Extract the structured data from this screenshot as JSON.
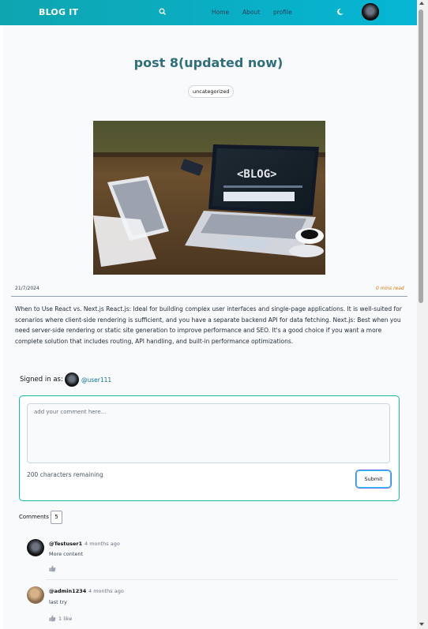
{
  "navbar": {
    "brand": "BLOG IT",
    "links": [
      "Home",
      "About",
      "profile"
    ]
  },
  "post": {
    "title": "post 8(updated now)",
    "category": "uncategorized",
    "date": "21/7/2024",
    "read_time": "0 mins read",
    "content": "When to Use React vs. Next.js React.js: Ideal for building complex user interfaces and single-page applications. It is well-suited for scenarios where client-side rendering is sufficient, and you have a separate backend API for data fetching. Next.js: Best when you need server-side rendering or static site generation to improve performance and SEO. It's a good choice if you want a more complete solution that includes routing, API handling, and built-in performance optimizations."
  },
  "comment_form": {
    "signed_in_label": "Signed in as:",
    "username": "@user111",
    "placeholder": "add your comment here...",
    "remaining": "200 characters remaining",
    "submit_label": "Submit"
  },
  "comments": {
    "label": "Comments",
    "count": "5",
    "items": [
      {
        "user": "@Testuser1",
        "time": "4 months ago",
        "text": "More content",
        "likes": ""
      },
      {
        "user": "@admin1234",
        "time": "4 months ago",
        "text": "last try",
        "likes": "1 like"
      }
    ]
  },
  "colors": {
    "navbar_gradient_start": "#0ea5b0",
    "navbar_gradient_end": "#06b6d4",
    "title": "#2f6f7c",
    "read_time": "#d97706",
    "accent": "#14b8a6"
  },
  "icons": [
    "search-icon",
    "moon-icon",
    "thumbs-up-icon"
  ]
}
